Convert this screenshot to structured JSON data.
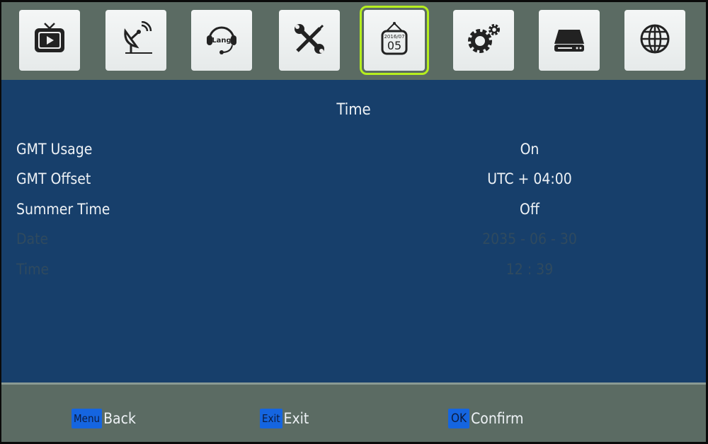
{
  "top_menu": {
    "items": [
      {
        "name": "tv",
        "icon": "tv-play-icon"
      },
      {
        "name": "satellite",
        "icon": "satellite-dish-icon"
      },
      {
        "name": "language",
        "icon": "headset-lang-icon",
        "icon_text": "Lang"
      },
      {
        "name": "tools",
        "icon": "wrench-screwdriver-icon"
      },
      {
        "name": "time",
        "icon": "calendar-icon",
        "icon_text_top": "2016/07",
        "icon_text_main": "05",
        "selected": true
      },
      {
        "name": "settings",
        "icon": "gears-icon"
      },
      {
        "name": "storage",
        "icon": "hard-drive-icon"
      },
      {
        "name": "network",
        "icon": "globe-icon"
      }
    ],
    "selected_color": "#b6ef1e"
  },
  "main": {
    "title": "Time",
    "rows": [
      {
        "label": "GMT Usage",
        "value": "On",
        "enabled": true
      },
      {
        "label": "GMT Offset",
        "value": "UTC + 04:00",
        "enabled": true
      },
      {
        "label": "Summer Time",
        "value": "Off",
        "enabled": true
      },
      {
        "label": "Date",
        "value": "2035  -  06  -  30",
        "enabled": false
      },
      {
        "label": "Time",
        "value": "12  :  39",
        "enabled": false
      }
    ]
  },
  "footer": {
    "hints": [
      {
        "key": "Menu",
        "action": "Back"
      },
      {
        "key": "Exit",
        "action": "Exit"
      },
      {
        "key": "OK",
        "action": "Confirm"
      }
    ]
  },
  "colors": {
    "panel_bg": "#173f6b",
    "frame_bg": "#5b6b63",
    "key_bg": "#1565e0"
  }
}
